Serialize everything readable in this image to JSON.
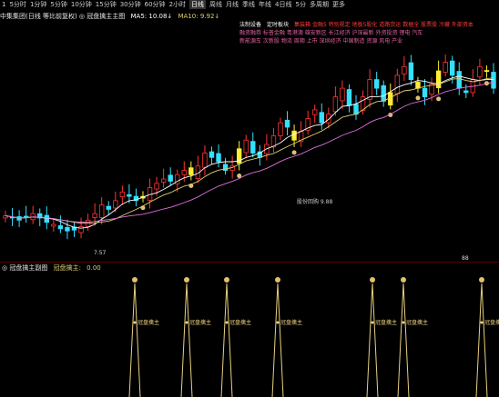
{
  "toolbar": {
    "items": [
      "1",
      "5分时",
      "1分钟",
      "5分钟",
      "10分钟",
      "15分钟",
      "30分钟",
      "60分钟",
      "2小时",
      "日线",
      "周线",
      "月线",
      "季线",
      "年线",
      "4日线",
      "5分",
      "多周期",
      "更多"
    ]
  },
  "main_title": {
    "stock": "中集集团(日线 等比前复权)",
    "indicator": "◎ 冠盘擒主主图",
    "ma5": "MA5: 10.08↓",
    "ma10": "MA10: 9.92↓"
  },
  "right_panel": {
    "tabs": [
      "法制设备",
      "定时板块"
    ],
    "tab_hl": "集装箱  金融5  特别规定  地板5股化  道路货运  数据全  股票股  冷藏  外部资本",
    "lines": [
      "融资融券  标普金融  粤港澳  雄安新区  长江经济  沪深最新  外资投资  锂电  汽车",
      "新能源车  次新股    物流    周期    上市    深圳经济  中国制造  资源  风电  产业"
    ]
  },
  "annotations": {
    "low_price": "7.57",
    "annot": "股份回购 9.88",
    "small_mark": "88"
  },
  "sub_chart": {
    "title": "◎ 冠盘擒主副图",
    "indicator": "冠盘擒主:",
    "value": "0.00",
    "signal_label": "冠盘擒主",
    "signals": 8
  },
  "colors": {
    "up": "#ff3333",
    "down": "#33e0ff",
    "signal": "#ffee33",
    "ma5": "#ffffff",
    "ma10": "#e0d070",
    "ma20": "#e070e0"
  },
  "chart_data": {
    "type": "candlestick",
    "ma_lines": [
      "MA5",
      "MA10",
      "MA20"
    ],
    "low_marker": 7.57,
    "series_close": [
      8.05,
      8.0,
      7.95,
      8.02,
      8.1,
      8.0,
      7.9,
      7.85,
      7.75,
      7.7,
      7.72,
      7.8,
      7.95,
      8.1,
      8.3,
      8.2,
      8.4,
      8.6,
      8.5,
      8.4,
      8.5,
      8.7,
      8.8,
      8.9,
      8.85,
      9.0,
      9.1,
      9.0,
      9.2,
      9.5,
      9.4,
      9.3,
      9.1,
      9.2,
      9.6,
      9.8,
      9.5,
      9.4,
      9.7,
      9.9,
      10.2,
      10.1,
      9.8,
      10.0,
      10.3,
      10.5,
      10.2,
      10.4,
      10.8,
      11.0,
      10.6,
      10.4,
      10.8,
      11.2,
      11.0,
      10.7,
      10.9,
      11.3,
      11.5,
      11.2,
      11.0,
      10.8,
      11.1,
      11.4,
      11.6,
      11.3,
      11.0,
      10.9,
      11.2,
      11.5,
      11.4,
      11.0
    ]
  }
}
